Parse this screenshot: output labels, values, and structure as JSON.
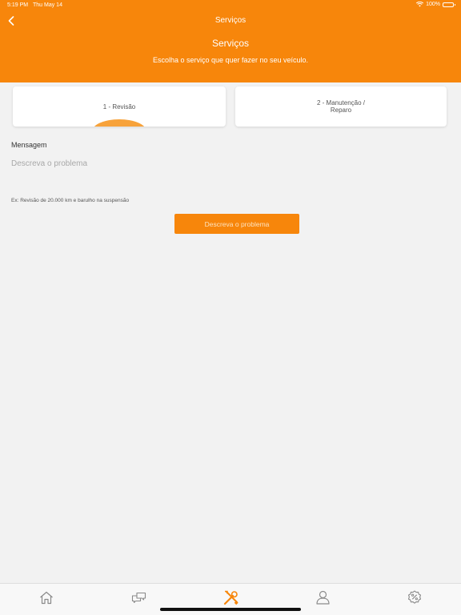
{
  "status_bar": {
    "time": "5:19 PM",
    "date": "Thu May 14",
    "battery": "100%"
  },
  "header": {
    "nav_title": "Serviços",
    "title": "Serviços",
    "subtitle": "Escolha o serviço que quer fazer no seu veículo."
  },
  "services": [
    {
      "label": "1 - Revisão",
      "selected": true
    },
    {
      "label": "2 - Manutenção / Reparo",
      "selected": false
    }
  ],
  "form": {
    "message_label": "Mensagem",
    "message_placeholder": "Descreva o problema",
    "message_value": "",
    "hint": "Ex: Revisão de 20.000 km e barulho na suspensão",
    "submit_label": "Descreva o problema"
  },
  "tab_bar": {
    "items": [
      {
        "icon": "home-icon",
        "active": false
      },
      {
        "icon": "chat-icon",
        "active": false
      },
      {
        "icon": "tools-icon",
        "active": true
      },
      {
        "icon": "profile-icon",
        "active": false
      },
      {
        "icon": "discount-icon",
        "active": false
      }
    ]
  },
  "colors": {
    "accent": "#f7860b",
    "background": "#f2f2f2",
    "inactive_icon": "#8a8a8a"
  }
}
